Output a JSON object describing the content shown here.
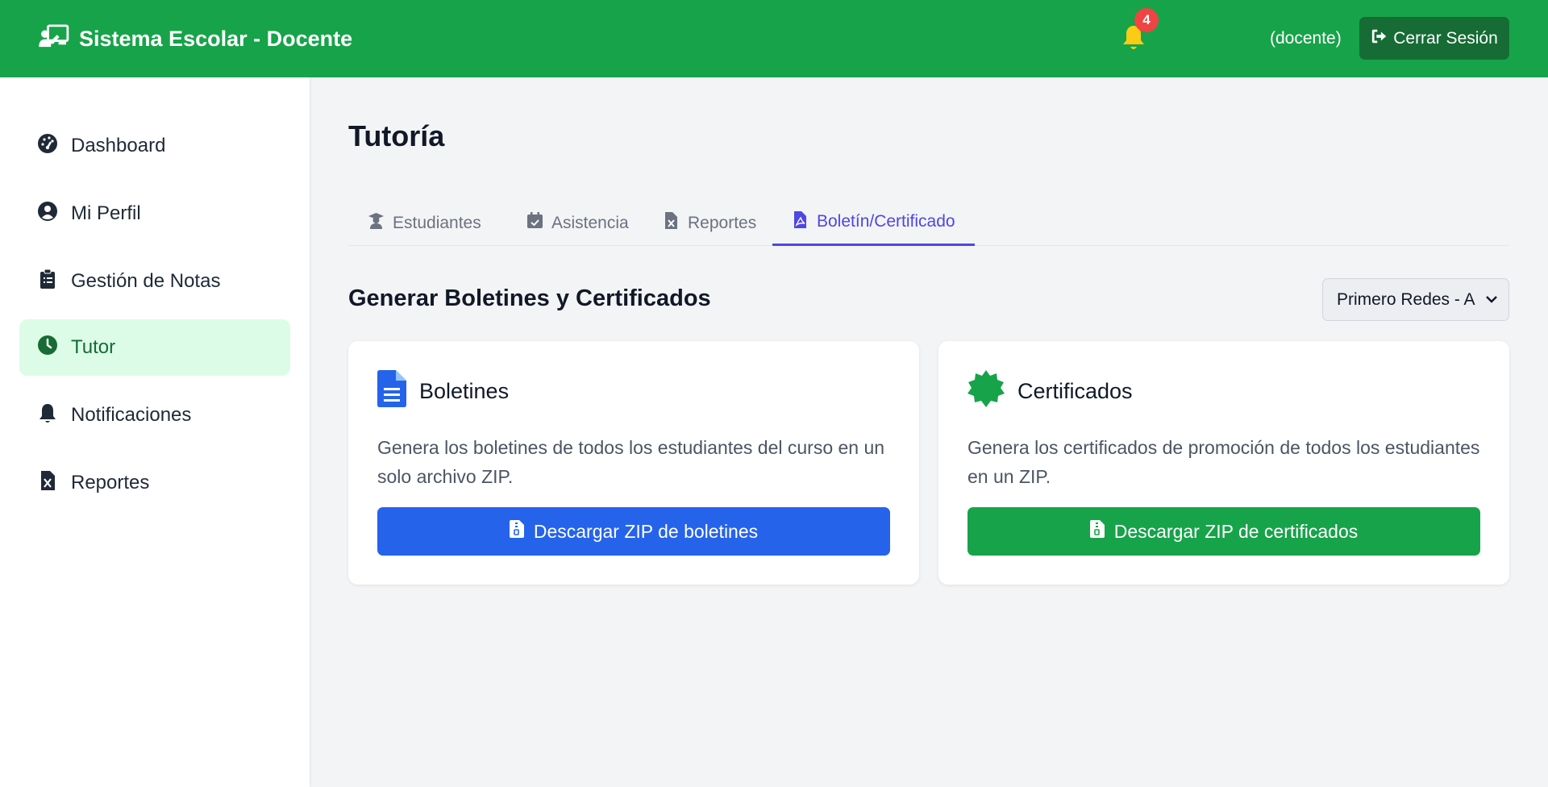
{
  "header": {
    "title": "Sistema Escolar - Docente",
    "notifications_count": "4",
    "role": "(docente)",
    "logout_label": "Cerrar Sesión",
    "brand_color": "#17a34a"
  },
  "sidebar": {
    "items": [
      {
        "label": "Dashboard",
        "icon": "gauge-icon"
      },
      {
        "label": "Mi Perfil",
        "icon": "user-circle-icon"
      },
      {
        "label": "Gestión de Notas",
        "icon": "clipboard-list-icon"
      },
      {
        "label": "Tutor",
        "icon": "clock-icon",
        "active": true
      },
      {
        "label": "Notificaciones",
        "icon": "bell-icon"
      },
      {
        "label": "Reportes",
        "icon": "file-excel-icon"
      }
    ]
  },
  "main": {
    "title": "Tutoría",
    "tabs": [
      {
        "label": "Estudiantes",
        "icon": "graduate-icon"
      },
      {
        "label": "Asistencia",
        "icon": "calendar-check-icon"
      },
      {
        "label": "Reportes",
        "icon": "file-excel-icon"
      },
      {
        "label": "Boletín/Certificado",
        "icon": "file-pdf-icon",
        "active": true
      }
    ],
    "section_title": "Generar Boletines y Certificados",
    "course_select": {
      "value": "Primero Redes - A"
    },
    "cards": [
      {
        "title": "Boletines",
        "icon": "file-lines-icon",
        "description": "Genera los boletines de todos los estudiantes del curso en un solo archivo ZIP.",
        "button_label": "Descargar ZIP de boletines",
        "color": "#2563eb"
      },
      {
        "title": "Certificados",
        "icon": "certificate-icon",
        "description": "Genera los certificados de promoción de todos los estudiantes en un ZIP.",
        "button_label": "Descargar ZIP de certificados",
        "color": "#17a34a"
      }
    ]
  }
}
